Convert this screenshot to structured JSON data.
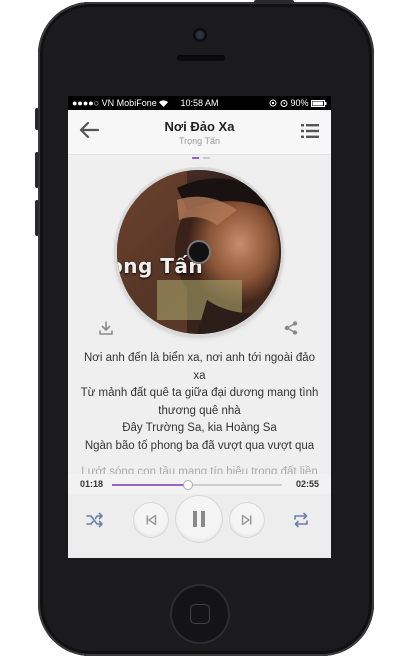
{
  "status_bar": {
    "carrier": "●●●●○ VN MobiFone",
    "wifi_icon": "wifi-icon",
    "time": "10:58 AM",
    "battery": "90%"
  },
  "header": {
    "back_icon": "back-arrow-icon",
    "title": "Nơi Đảo Xa",
    "artist": "Trọng Tấn",
    "menu_icon": "playlist-icon"
  },
  "album_art": {
    "overlay_text": "ọng Tấn"
  },
  "lyrics": {
    "lines": [
      "Nơi anh đến là biển xa, nơi anh tới ngoài đảo xa",
      "Từ mảnh đất quê ta giữa đại dương mang tình",
      "thương quê nhà",
      "Đây Trường Sa, kia Hoàng Sa",
      "Ngàn bão tố phong ba đã vượt qua vượt qua"
    ],
    "next_line": "Lướt sóng con tầu mang tín hiệu trong đất liền"
  },
  "player": {
    "current_time": "01:18",
    "total_time": "02:55",
    "progress_fraction": 0.446
  },
  "colors": {
    "accent": "#9b62c9",
    "screen_bg": "#efefef"
  }
}
